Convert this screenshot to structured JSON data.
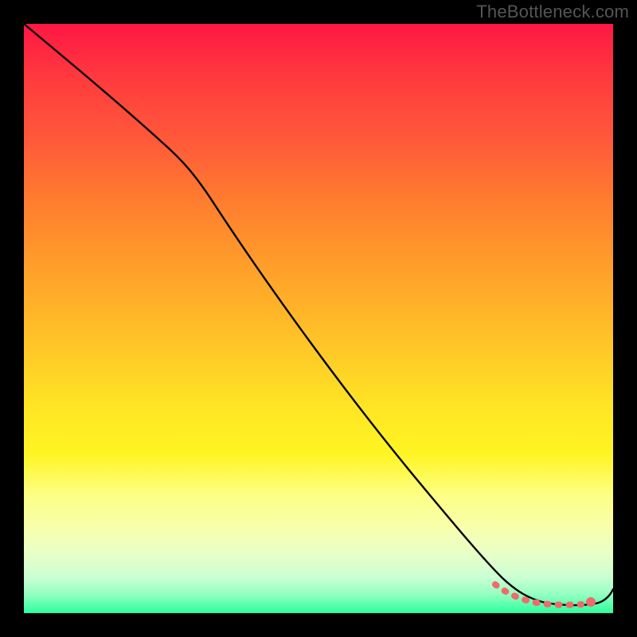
{
  "watermark": "TheBottleneck.com",
  "chart_data": {
    "type": "line",
    "title": "",
    "xlabel": "",
    "ylabel": "",
    "xlim": [
      0,
      100
    ],
    "ylim": [
      0,
      100
    ],
    "series": [
      {
        "name": "bottleneck-curve",
        "color": "#000000",
        "x": [
          0,
          10,
          20,
          25,
          30,
          40,
          50,
          60,
          70,
          78,
          82,
          86,
          90,
          94,
          97,
          100
        ],
        "y": [
          100,
          92,
          84,
          79,
          73,
          60,
          47,
          34,
          21,
          10,
          5,
          2,
          1,
          1,
          2,
          5
        ]
      },
      {
        "name": "optimal-range-marker",
        "color": "#f06a6a",
        "x": [
          80,
          82,
          84,
          86,
          88,
          90,
          92,
          94
        ],
        "y": [
          3.5,
          3.0,
          2.6,
          2.2,
          2.0,
          1.8,
          1.8,
          1.8
        ]
      }
    ],
    "markers": [
      {
        "name": "end-dot",
        "x": 95.5,
        "y": 2.2,
        "color": "#f06a6a"
      }
    ],
    "gradient_stops": [
      {
        "pos": 0,
        "color": "#ff1744"
      },
      {
        "pos": 50,
        "color": "#ffc727"
      },
      {
        "pos": 75,
        "color": "#fff523"
      },
      {
        "pos": 100,
        "color": "#2bff9e"
      }
    ]
  }
}
